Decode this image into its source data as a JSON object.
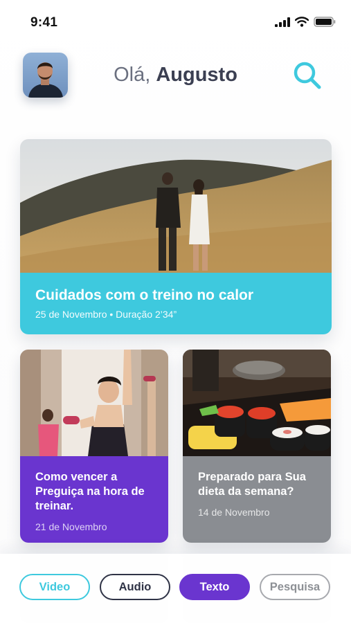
{
  "status_bar": {
    "time": "9:41",
    "icons": [
      "signal-icon",
      "wifi-icon",
      "battery-icon"
    ]
  },
  "header": {
    "greeting_prefix": "Olá,",
    "user_name": "Augusto",
    "avatar": "avatar",
    "search_icon": "search-icon"
  },
  "featured": {
    "title": "Cuidados com o treino no calor",
    "meta": "25 de Novembro • Duração 2’34”",
    "image": "couple-hiking-photo"
  },
  "cards": [
    {
      "title": "Como vencer a Preguiça na hora de treinar.",
      "date": "21 de Novembro",
      "image": "gym-workout-photo"
    },
    {
      "title": "Preparado para Sua dieta da semana?",
      "date": "14 de Novembro",
      "image": "sushi-photo"
    }
  ],
  "tabs": {
    "video": "Video",
    "audio": "Audio",
    "texto": "Texto",
    "pesquisa": "Pesquisa",
    "active": "texto"
  },
  "colors": {
    "accent_cyan": "#3ec9de",
    "accent_purple": "#6a35cf",
    "neutral_grey": "#8a8d92",
    "text_dark": "#2f3346"
  }
}
